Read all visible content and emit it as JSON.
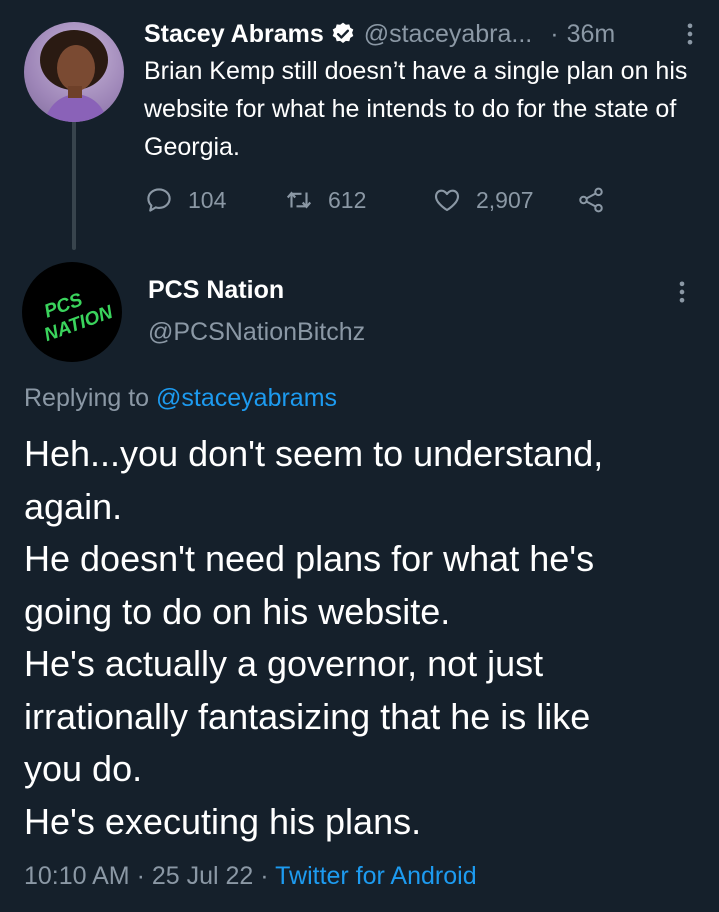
{
  "parent_tweet": {
    "author_name": "Stacey Abrams",
    "handle": "@staceyabra...",
    "separator": "·",
    "time_ago": "36m",
    "text": "Brian Kemp still doesn’t have a single plan on his website for what he intends to do for the state of Georgia.",
    "replies": "104",
    "retweets": "612",
    "likes": "2,907"
  },
  "reply_tweet": {
    "author_name": "PCS Nation",
    "handle": "@PCSNationBitchz",
    "avatar_text": [
      "PCS",
      "NATION"
    ],
    "replying_prefix": "Replying to ",
    "replying_to": "@staceyabrams",
    "lines": [
      "Heh...you don't seem to understand,",
      "again.",
      "He doesn't need plans for what he's",
      "going to do on his website.",
      "He's actually a governor, not just",
      "irrationally fantasizing that he is like",
      "you do.",
      "He's executing his plans."
    ],
    "time": "10:10 AM",
    "date": "25 Jul 22",
    "separator": "·",
    "source": "Twitter for Android"
  },
  "colors": {
    "background": "#15202b",
    "secondary_text": "#8b98a5",
    "link": "#1d9bf0",
    "avatar_text": "#3ad35c"
  }
}
